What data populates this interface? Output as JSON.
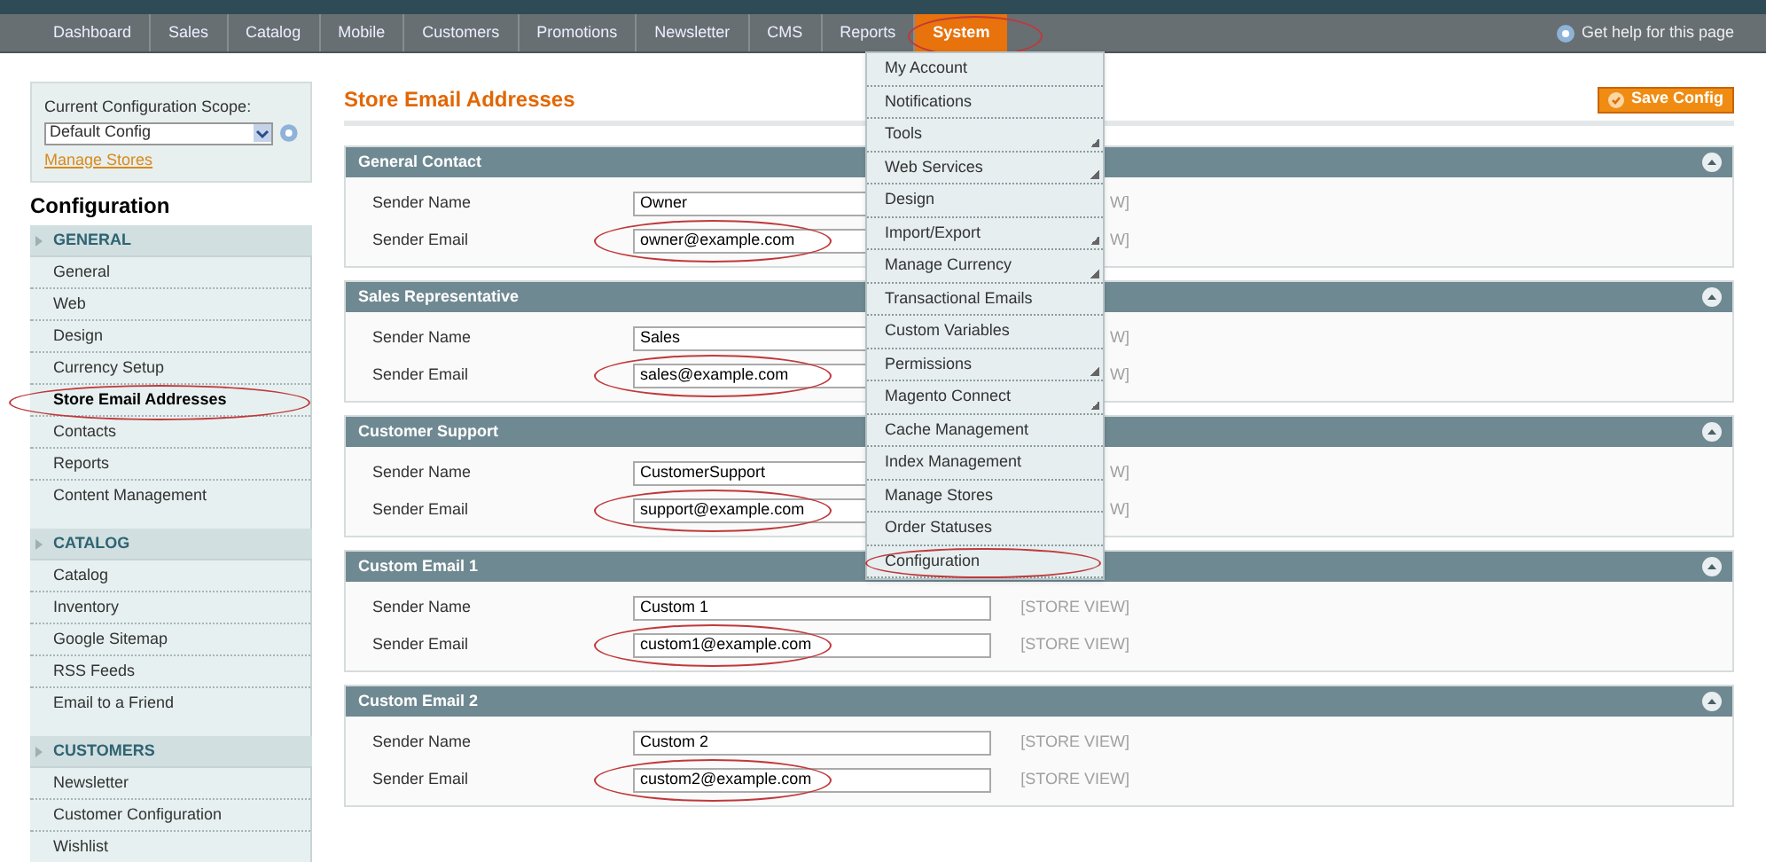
{
  "nav": {
    "items": [
      {
        "label": "Dashboard",
        "selected": false,
        "circled": false
      },
      {
        "label": "Sales",
        "selected": false,
        "circled": false
      },
      {
        "label": "Catalog",
        "selected": false,
        "circled": false
      },
      {
        "label": "Mobile",
        "selected": false,
        "circled": false
      },
      {
        "label": "Customers",
        "selected": false,
        "circled": false
      },
      {
        "label": "Promotions",
        "selected": false,
        "circled": false
      },
      {
        "label": "Newsletter",
        "selected": false,
        "circled": false
      },
      {
        "label": "CMS",
        "selected": false,
        "circled": false
      },
      {
        "label": "Reports",
        "selected": false,
        "circled": false
      },
      {
        "label": "System",
        "selected": true,
        "circled": true
      }
    ],
    "help": "Get help for this page"
  },
  "menu": {
    "items": [
      {
        "label": "My Account",
        "submenu": false,
        "circled": false
      },
      {
        "label": "Notifications",
        "submenu": false,
        "circled": false
      },
      {
        "label": "Tools",
        "submenu": true,
        "circled": false
      },
      {
        "label": "Web Services",
        "submenu": true,
        "circled": false
      },
      {
        "label": "Design",
        "submenu": false,
        "circled": false
      },
      {
        "label": "Import/Export",
        "submenu": true,
        "circled": false
      },
      {
        "label": "Manage Currency",
        "submenu": true,
        "circled": false
      },
      {
        "label": "Transactional Emails",
        "submenu": false,
        "circled": false
      },
      {
        "label": "Custom Variables",
        "submenu": false,
        "circled": false
      },
      {
        "label": "Permissions",
        "submenu": true,
        "circled": false
      },
      {
        "label": "Magento Connect",
        "submenu": true,
        "circled": false
      },
      {
        "label": "Cache Management",
        "submenu": false,
        "circled": false
      },
      {
        "label": "Index Management",
        "submenu": false,
        "circled": false
      },
      {
        "label": "Manage Stores",
        "submenu": false,
        "circled": false
      },
      {
        "label": "Order Statuses",
        "submenu": false,
        "circled": false
      },
      {
        "label": "Configuration",
        "submenu": false,
        "circled": true
      }
    ]
  },
  "scope": {
    "label": "Current Configuration Scope:",
    "value": "Default Config",
    "link": "Manage Stores"
  },
  "sidebar": {
    "title": "Configuration",
    "groups": [
      {
        "title": "GENERAL",
        "items": [
          {
            "label": "General",
            "selected": false,
            "circled": false
          },
          {
            "label": "Web",
            "selected": false,
            "circled": false
          },
          {
            "label": "Design",
            "selected": false,
            "circled": false
          },
          {
            "label": "Currency Setup",
            "selected": false,
            "circled": false
          },
          {
            "label": "Store Email Addresses",
            "selected": true,
            "circled": true
          },
          {
            "label": "Contacts",
            "selected": false,
            "circled": false
          },
          {
            "label": "Reports",
            "selected": false,
            "circled": false
          },
          {
            "label": "Content Management",
            "selected": false,
            "circled": false
          }
        ]
      },
      {
        "title": "CATALOG",
        "items": [
          {
            "label": "Catalog",
            "selected": false,
            "circled": false
          },
          {
            "label": "Inventory",
            "selected": false,
            "circled": false
          },
          {
            "label": "Google Sitemap",
            "selected": false,
            "circled": false
          },
          {
            "label": "RSS Feeds",
            "selected": false,
            "circled": false
          },
          {
            "label": "Email to a Friend",
            "selected": false,
            "circled": false
          }
        ]
      },
      {
        "title": "CUSTOMERS",
        "items": [
          {
            "label": "Newsletter",
            "selected": false,
            "circled": false
          },
          {
            "label": "Customer Configuration",
            "selected": false,
            "circled": false
          },
          {
            "label": "Wishlist",
            "selected": false,
            "circled": false
          }
        ]
      }
    ]
  },
  "page": {
    "title": "Store Email Addresses",
    "save_button": "Save Config"
  },
  "sections": [
    {
      "title": "General Contact",
      "rows": [
        {
          "label": "Sender Name",
          "value": "Owner",
          "scope": "W]",
          "circled": false
        },
        {
          "label": "Sender Email",
          "value": "owner@example.com",
          "scope": "W]",
          "circled": true
        }
      ]
    },
    {
      "title": "Sales Representative",
      "rows": [
        {
          "label": "Sender Name",
          "value": "Sales",
          "scope": "W]",
          "circled": false
        },
        {
          "label": "Sender Email",
          "value": "sales@example.com",
          "scope": "W]",
          "circled": true
        }
      ]
    },
    {
      "title": "Customer Support",
      "rows": [
        {
          "label": "Sender Name",
          "value": "CustomerSupport",
          "scope": "W]",
          "circled": false
        },
        {
          "label": "Sender Email",
          "value": "support@example.com",
          "scope": "W]",
          "circled": true
        }
      ]
    },
    {
      "title": "Custom Email 1",
      "rows": [
        {
          "label": "Sender Name",
          "value": "Custom 1",
          "scope": "[STORE VIEW]",
          "circled": false
        },
        {
          "label": "Sender Email",
          "value": "custom1@example.com",
          "scope": "[STORE VIEW]",
          "circled": true
        }
      ]
    },
    {
      "title": "Custom Email 2",
      "rows": [
        {
          "label": "Sender Name",
          "value": "Custom 2",
          "scope": "[STORE VIEW]",
          "circled": false
        },
        {
          "label": "Sender Email",
          "value": "custom2@example.com",
          "scope": "[STORE VIEW]",
          "circled": true
        }
      ]
    }
  ]
}
